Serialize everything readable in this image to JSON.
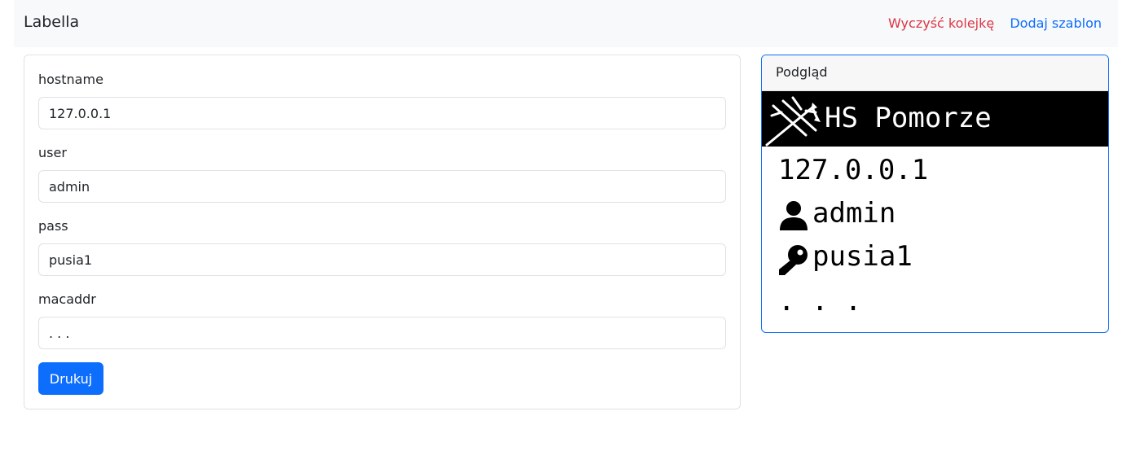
{
  "navbar": {
    "brand": "Labella",
    "clear_queue": "Wyczyść kolejkę",
    "add_template": "Dodaj szablon",
    "colors": {
      "danger": "#dc3545",
      "primary": "#0d6efd"
    }
  },
  "form": {
    "fields": [
      {
        "label": "hostname",
        "value": "127.0.0.1"
      },
      {
        "label": "user",
        "value": "admin"
      },
      {
        "label": "pass",
        "value": "pusia1"
      },
      {
        "label": "macaddr",
        "value": ". . ."
      }
    ],
    "print_button": "Drukuj"
  },
  "preview": {
    "title": "Podgląd",
    "label": {
      "header": "HS Pomorze",
      "logo_icon": "trident-icon",
      "hostname": "127.0.0.1",
      "user_icon": "user-icon",
      "user": "admin",
      "pass_icon": "key-icon",
      "pass": "pusia1",
      "macaddr": ". . ."
    }
  }
}
